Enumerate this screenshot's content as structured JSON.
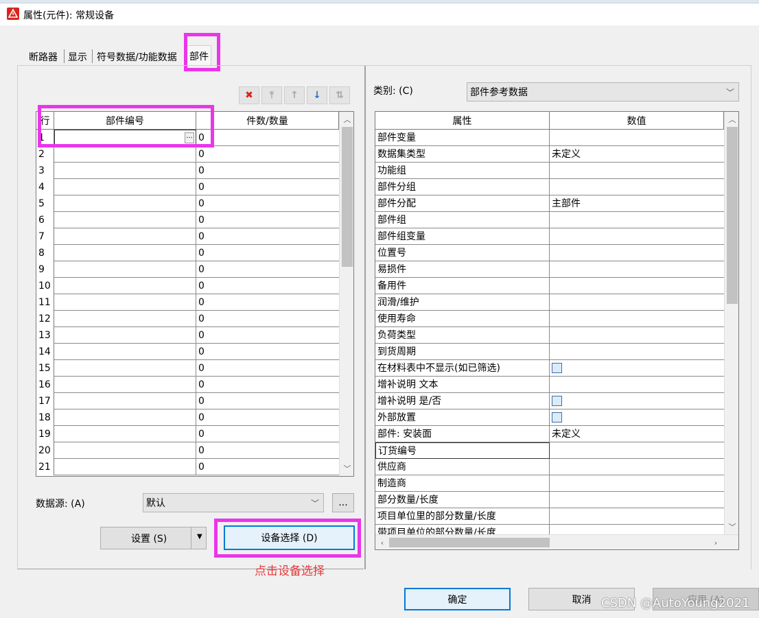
{
  "window": {
    "title": "属性(元件): 常规设备"
  },
  "tabs": [
    "断路器",
    "显示",
    "符号数据/功能数据",
    "部件"
  ],
  "left": {
    "toolbar_icons": [
      "delete-icon",
      "move-top-icon",
      "move-up-icon",
      "move-down-icon",
      "sort-icon"
    ],
    "grid": {
      "headers": {
        "row": "行",
        "part_no": "部件编号",
        "qty": "件数/数量"
      },
      "ellipsis": "...",
      "rows": [
        {
          "n": "1",
          "qty": "0"
        },
        {
          "n": "2",
          "qty": "0"
        },
        {
          "n": "3",
          "qty": "0"
        },
        {
          "n": "4",
          "qty": "0"
        },
        {
          "n": "5",
          "qty": "0"
        },
        {
          "n": "6",
          "qty": "0"
        },
        {
          "n": "7",
          "qty": "0"
        },
        {
          "n": "8",
          "qty": "0"
        },
        {
          "n": "9",
          "qty": "0"
        },
        {
          "n": "10",
          "qty": "0"
        },
        {
          "n": "11",
          "qty": "0"
        },
        {
          "n": "12",
          "qty": "0"
        },
        {
          "n": "13",
          "qty": "0"
        },
        {
          "n": "14",
          "qty": "0"
        },
        {
          "n": "15",
          "qty": "0"
        },
        {
          "n": "16",
          "qty": "0"
        },
        {
          "n": "17",
          "qty": "0"
        },
        {
          "n": "18",
          "qty": "0"
        },
        {
          "n": "19",
          "qty": "0"
        },
        {
          "n": "20",
          "qty": "0"
        },
        {
          "n": "21",
          "qty": "0"
        }
      ]
    },
    "datasource": {
      "label": "数据源: (A)",
      "value": "默认",
      "browse": "..."
    },
    "settings_button": "设置 (S)",
    "device_select_button": "设备选择 (D)",
    "annotation": "点击设备选择"
  },
  "right": {
    "category": {
      "label": "类别: (C)",
      "value": "部件参考数据"
    },
    "grid": {
      "headers": {
        "prop": "属性",
        "value": "数值"
      },
      "rows": [
        {
          "prop": "部件变量",
          "value": ""
        },
        {
          "prop": "数据集类型",
          "value": "未定义"
        },
        {
          "prop": "功能组",
          "value": ""
        },
        {
          "prop": "部件分组",
          "value": ""
        },
        {
          "prop": "部件分配",
          "value": "主部件"
        },
        {
          "prop": "部件组",
          "value": ""
        },
        {
          "prop": "部件组变量",
          "value": ""
        },
        {
          "prop": "位置号",
          "value": ""
        },
        {
          "prop": "易损件",
          "value": ""
        },
        {
          "prop": "备用件",
          "value": ""
        },
        {
          "prop": "润滑/维护",
          "value": ""
        },
        {
          "prop": "使用寿命",
          "value": ""
        },
        {
          "prop": "负荷类型",
          "value": ""
        },
        {
          "prop": "到货周期",
          "value": ""
        },
        {
          "prop": "在材料表中不显示(如已筛选)",
          "value": "",
          "checkbox": true
        },
        {
          "prop": "增补说明 文本",
          "value": ""
        },
        {
          "prop": "增补说明 是/否",
          "value": "",
          "checkbox": true
        },
        {
          "prop": "外部放置",
          "value": "",
          "checkbox": true
        },
        {
          "prop": "部件: 安装面",
          "value": "未定义"
        },
        {
          "prop": "订货编号",
          "value": ""
        },
        {
          "prop": "供应商",
          "value": ""
        },
        {
          "prop": "制造商",
          "value": ""
        },
        {
          "prop": "部分数量/长度",
          "value": ""
        },
        {
          "prop": "项目单位里的部分数量/长度",
          "value": ""
        },
        {
          "prop": "带项目单位的部分数量/长度",
          "value": ""
        }
      ]
    }
  },
  "footer": {
    "ok": "确定",
    "cancel": "取消",
    "apply": "应用 (A)"
  },
  "watermark": "CSDN @AutoYoung2021",
  "colors": {
    "highlight": "#ea35ea",
    "annotation": "#e8383b",
    "primary_border": "#0078d7"
  }
}
